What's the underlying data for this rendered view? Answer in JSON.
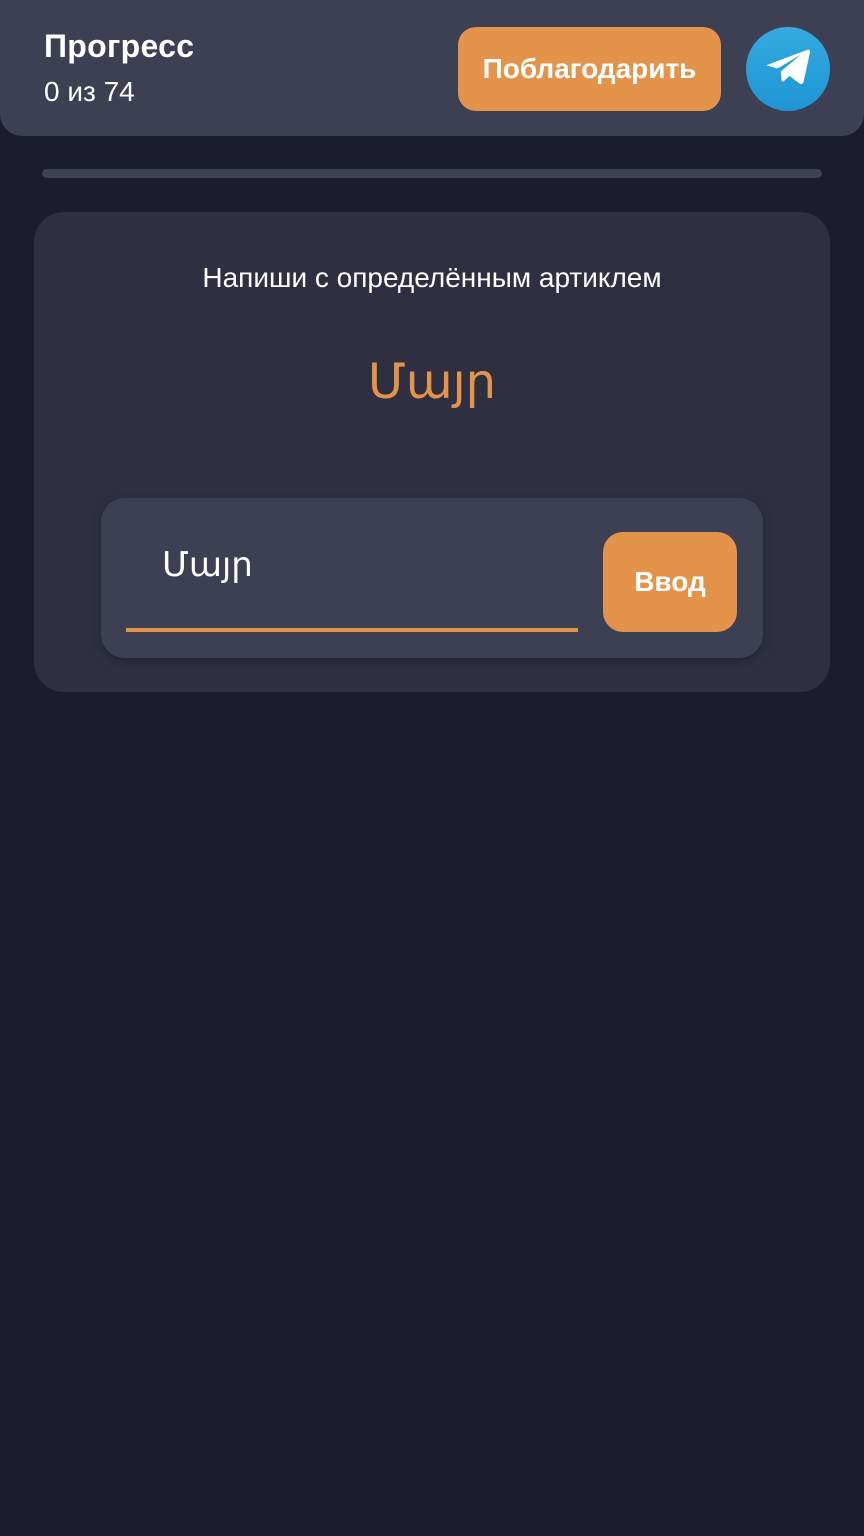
{
  "header": {
    "progress_title": "Прогресс",
    "progress_count": "0 из 74",
    "thank_label": "Поблагодарить",
    "telegram_icon": "telegram-paper-plane-icon"
  },
  "progress": {
    "completed": 0,
    "total": 74
  },
  "exercise": {
    "instruction": "Напиши с определённым артиклем",
    "word": "Մայր",
    "input_value": "Մայր",
    "submit_label": "Ввод"
  },
  "colors": {
    "accent": "#e4934a",
    "background": "#1b1c2d",
    "panel": "#3d3f53",
    "card": "#2e3042",
    "telegram": "#2aa3dc"
  }
}
